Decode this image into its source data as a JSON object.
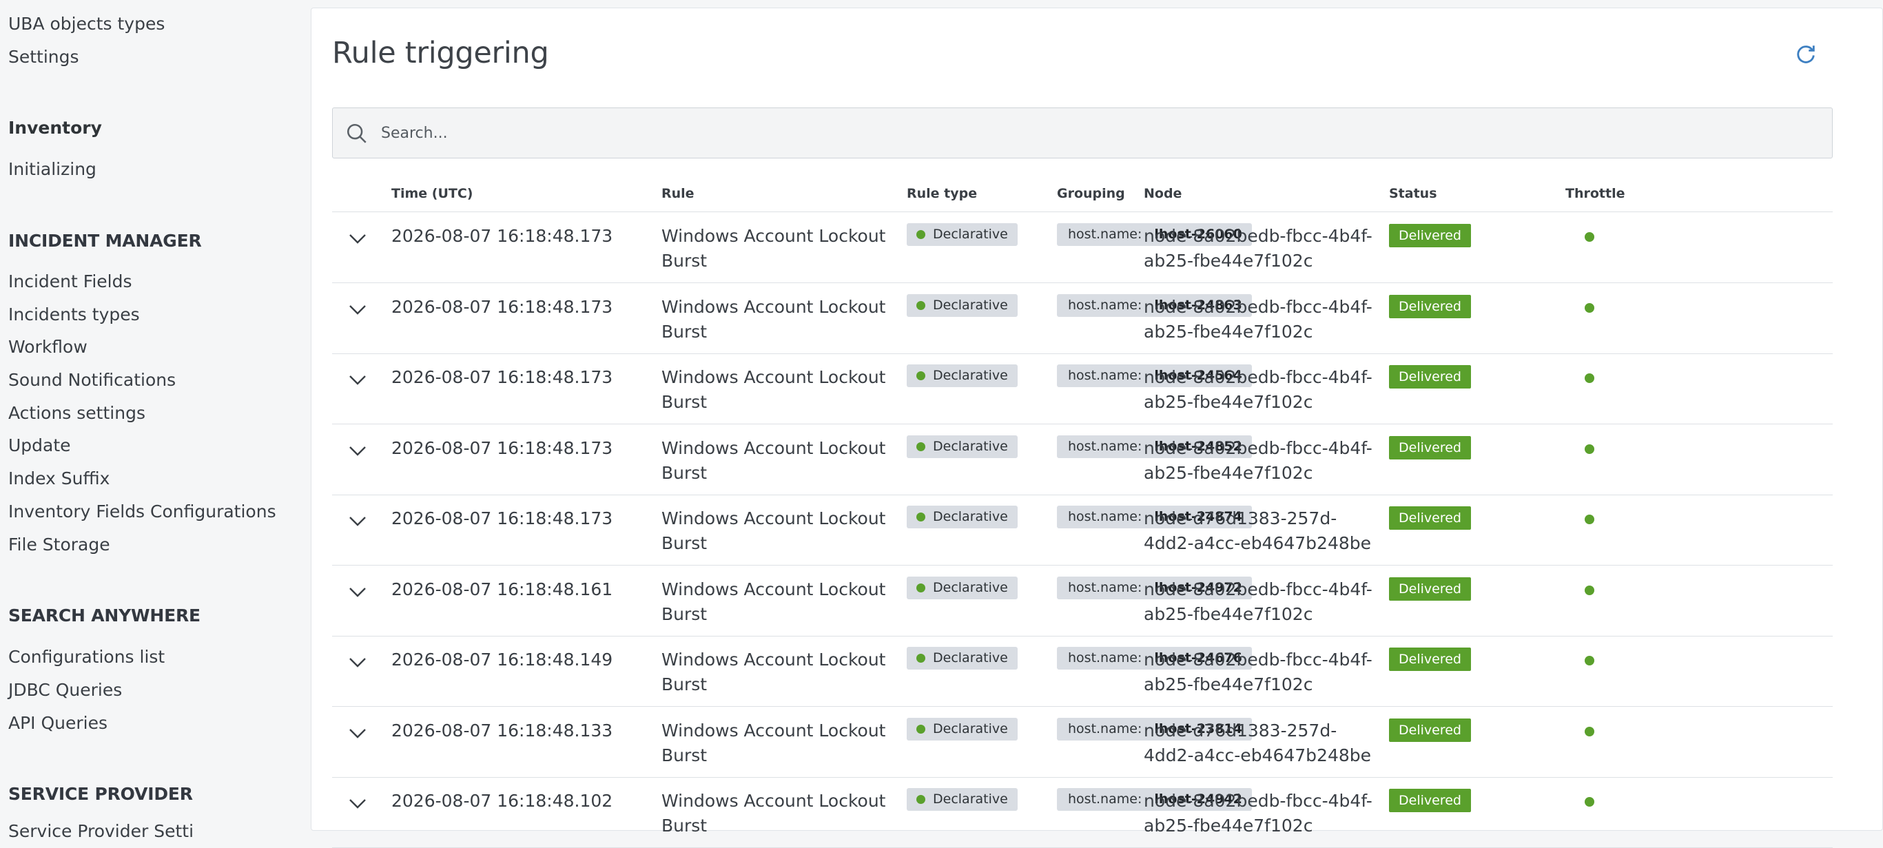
{
  "sidebar": {
    "items_top": [
      "UBA objects types",
      "Settings"
    ],
    "inventory": {
      "heading": "Inventory",
      "items": [
        "Initializing"
      ]
    },
    "incident_manager": {
      "heading": "INCIDENT MANAGER",
      "items": [
        "Incident Fields",
        "Incidents types",
        "Workflow",
        "Sound Notifications",
        "Actions settings",
        "Update",
        "Index Suffix",
        "Inventory Fields Configurations",
        "File Storage"
      ]
    },
    "search_anywhere": {
      "heading": "SEARCH ANYWHERE",
      "items": [
        "Configurations list",
        "JDBC Queries",
        "API Queries"
      ]
    },
    "service_provider": {
      "heading": "SERVICE PROVIDER",
      "partial_item": "Service Provider Setti"
    }
  },
  "main": {
    "title": "Rule triggering",
    "refresh_icon": "refresh-icon",
    "search": {
      "placeholder": "Search...",
      "value": "",
      "icon": "search-icon"
    },
    "columns": [
      "Time (UTC)",
      "Rule",
      "Rule type",
      "Grouping",
      "Node",
      "Status",
      "Throttle"
    ],
    "rows": [
      {
        "time": "2026-08-07 16:18:48.173",
        "rule": "Windows Account Lockout Burst",
        "rule_type": "Declarative",
        "group_key": "host.name:",
        "group_value": "lhost-26060",
        "node": "node-8a02bedb-fbcc-4b4f-ab25-fbe44e7f102c",
        "status": "Delivered"
      },
      {
        "time": "2026-08-07 16:18:48.173",
        "rule": "Windows Account Lockout Burst",
        "rule_type": "Declarative",
        "group_key": "host.name:",
        "group_value": "lhost-24863",
        "node": "node-8a02bedb-fbcc-4b4f-ab25-fbe44e7f102c",
        "status": "Delivered"
      },
      {
        "time": "2026-08-07 16:18:48.173",
        "rule": "Windows Account Lockout Burst",
        "rule_type": "Declarative",
        "group_key": "host.name:",
        "group_value": "lhost-24564",
        "node": "node-8a02bedb-fbcc-4b4f-ab25-fbe44e7f102c",
        "status": "Delivered"
      },
      {
        "time": "2026-08-07 16:18:48.173",
        "rule": "Windows Account Lockout Burst",
        "rule_type": "Declarative",
        "group_key": "host.name:",
        "group_value": "lhost-24852",
        "node": "node-8a02bedb-fbcc-4b4f-ab25-fbe44e7f102c",
        "status": "Delivered"
      },
      {
        "time": "2026-08-07 16:18:48.173",
        "rule": "Windows Account Lockout Burst",
        "rule_type": "Declarative",
        "group_key": "host.name:",
        "group_value": "lhost-24874",
        "node": "node-d76d1383-257d-4dd2-a4cc-eb4647b248be",
        "status": "Delivered"
      },
      {
        "time": "2026-08-07 16:18:48.161",
        "rule": "Windows Account Lockout Burst",
        "rule_type": "Declarative",
        "group_key": "host.name:",
        "group_value": "lhost-24972",
        "node": "node-8a02bedb-fbcc-4b4f-ab25-fbe44e7f102c",
        "status": "Delivered"
      },
      {
        "time": "2026-08-07 16:18:48.149",
        "rule": "Windows Account Lockout Burst",
        "rule_type": "Declarative",
        "group_key": "host.name:",
        "group_value": "lhost-24676",
        "node": "node-8a02bedb-fbcc-4b4f-ab25-fbe44e7f102c",
        "status": "Delivered"
      },
      {
        "time": "2026-08-07 16:18:48.133",
        "rule": "Windows Account Lockout Burst",
        "rule_type": "Declarative",
        "group_key": "host.name:",
        "group_value": "lhost-23814",
        "node": "node-d76d1383-257d-4dd2-a4cc-eb4647b248be",
        "status": "Delivered"
      },
      {
        "time": "2026-08-07 16:18:48.102",
        "rule": "Windows Account Lockout Burst",
        "rule_type": "Declarative",
        "group_key": "host.name:",
        "group_value": "lhost-24942",
        "node": "node-8a02bedb-fbcc-4b4f-ab25-fbe44e7f102c",
        "status": "Delivered"
      }
    ]
  },
  "colors": {
    "accent_green": "#5aa02c",
    "badge_grey": "#d9dde3",
    "background": "#f5f6f7"
  }
}
